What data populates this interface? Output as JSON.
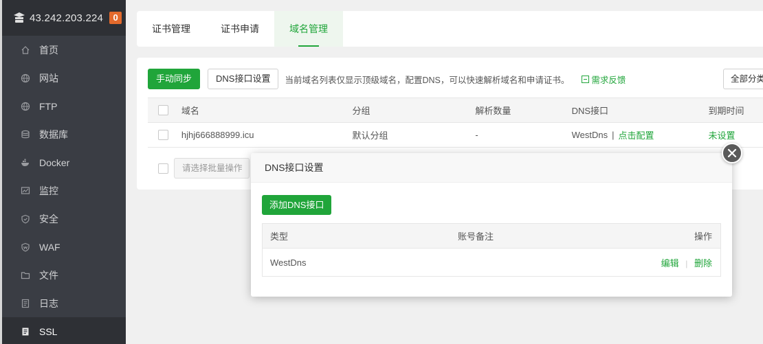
{
  "sidebar": {
    "ip": "43.242.203.224",
    "badge": "0",
    "items": [
      {
        "label": "首页",
        "icon": "home-icon"
      },
      {
        "label": "网站",
        "icon": "globe-icon"
      },
      {
        "label": "FTP",
        "icon": "ftp-globe-icon"
      },
      {
        "label": "数据库",
        "icon": "database-icon"
      },
      {
        "label": "Docker",
        "icon": "docker-icon"
      },
      {
        "label": "监控",
        "icon": "monitor-icon"
      },
      {
        "label": "安全",
        "icon": "shield-icon"
      },
      {
        "label": "WAF",
        "icon": "waf-shield-icon"
      },
      {
        "label": "文件",
        "icon": "folder-icon"
      },
      {
        "label": "日志",
        "icon": "log-icon"
      },
      {
        "label": "SSL",
        "icon": "ssl-icon"
      }
    ],
    "active_index": 10
  },
  "tabs": [
    {
      "label": "证书管理"
    },
    {
      "label": "证书申请"
    },
    {
      "label": "域名管理"
    }
  ],
  "active_tab": 2,
  "toolbar": {
    "sync_label": "手动同步",
    "dns_settings_label": "DNS接口设置",
    "tip": "当前域名列表仅显示顶级域名，配置DNS，可以快速解析域名和申请证书。",
    "feedback_label": "需求反馈",
    "category_label": "全部分类"
  },
  "domain_table": {
    "headers": {
      "name": "域名",
      "group": "分组",
      "count": "解析数量",
      "dns": "DNS接口",
      "expire": "到期时间"
    },
    "rows": [
      {
        "name": "hjhj666888999.icu",
        "group": "默认分组",
        "count": "-",
        "dns": "WestDns",
        "dns_action": "点击配置",
        "expire": "未设置"
      }
    ]
  },
  "batch": {
    "placeholder": "请选择批量操作"
  },
  "modal": {
    "title": "DNS接口设置",
    "add_label": "添加DNS接口",
    "headers": {
      "type": "类型",
      "note": "账号备注",
      "action": "操作"
    },
    "rows": [
      {
        "type": "WestDns",
        "note": "",
        "edit": "编辑",
        "delete": "删除"
      }
    ]
  },
  "colors": {
    "accent": "#20a53a",
    "badge": "#e36a2c",
    "sidebar_bg": "#3a3d44"
  }
}
